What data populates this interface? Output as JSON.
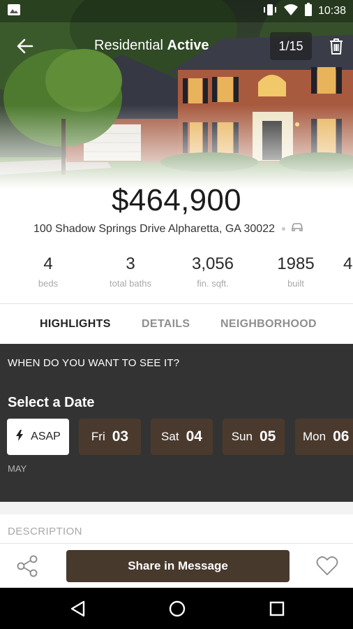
{
  "status_bar": {
    "time": "10:38",
    "icons": [
      "image-notification-icon",
      "vibrate-icon",
      "wifi-icon",
      "battery-icon"
    ]
  },
  "app_bar": {
    "title_prefix": "Residential",
    "title_status": "Active",
    "photo_counter": "1/15",
    "icons": [
      "back-arrow-icon",
      "trash-icon"
    ]
  },
  "listing": {
    "price": "$464,900",
    "address": "100 Shadow Springs Drive Alpharetta, GA 30022",
    "stats": [
      {
        "value": "4",
        "label": "beds"
      },
      {
        "value": "3",
        "label": "total baths"
      },
      {
        "value": "3,056",
        "label": "fin. sqft."
      },
      {
        "value": "1985",
        "label": "built"
      },
      {
        "value": "4",
        "label": ""
      }
    ]
  },
  "tabs": [
    {
      "label": "HIGHLIGHTS",
      "active": true
    },
    {
      "label": "DETAILS",
      "active": false
    },
    {
      "label": "NEIGHBORHOOD",
      "active": false
    }
  ],
  "schedule": {
    "question": "WHEN DO YOU WANT TO SEE IT?",
    "select_date_label": "Select a Date",
    "asap_label": "ASAP",
    "dates": [
      {
        "day": "Fri",
        "num": "03"
      },
      {
        "day": "Sat",
        "num": "04"
      },
      {
        "day": "Sun",
        "num": "05"
      },
      {
        "day": "Mon",
        "num": "06"
      }
    ],
    "month": "MAY"
  },
  "description": {
    "label": "DESCRIPTION"
  },
  "action_bar": {
    "share_message_label": "Share in Message"
  },
  "colors": {
    "brand_brown": "#48392d",
    "chip_brown": "#4a3a2e",
    "panel_dark": "#333333"
  }
}
